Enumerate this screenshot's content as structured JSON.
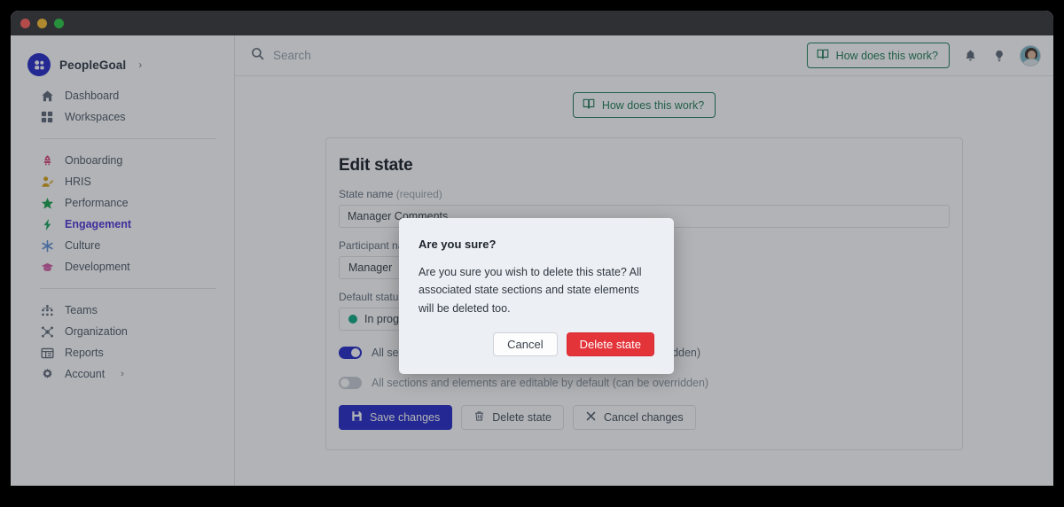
{
  "window": {
    "traffic_lights": [
      "close",
      "minimize",
      "maximize"
    ]
  },
  "sidebar": {
    "brand": {
      "name": "PeopleGoal",
      "caret": "›",
      "logo_icon": "peoplegoal-logo-icon"
    },
    "groups": [
      {
        "items": [
          {
            "label": "Dashboard",
            "icon": "home-icon",
            "color": "#5c6674",
            "active": false
          },
          {
            "label": "Workspaces",
            "icon": "grid-icon",
            "color": "#5c6674",
            "active": false
          }
        ]
      },
      {
        "items": [
          {
            "label": "Onboarding",
            "icon": "rocket-icon",
            "color": "#d93d7a",
            "active": false
          },
          {
            "label": "HRIS",
            "icon": "user-edit-icon",
            "color": "#d8a212",
            "active": false
          },
          {
            "label": "Performance",
            "icon": "star-icon",
            "color": "#17a24a",
            "active": false
          },
          {
            "label": "Engagement",
            "icon": "lightning-icon",
            "color": "#18a558",
            "active": true
          },
          {
            "label": "Culture",
            "icon": "asterisk-icon",
            "color": "#5b8ed6",
            "active": false
          },
          {
            "label": "Development",
            "icon": "graduation-cap-icon",
            "color": "#d559a5",
            "active": false
          }
        ]
      },
      {
        "items": [
          {
            "label": "Teams",
            "icon": "teams-icon",
            "color": "#5c6674",
            "active": false
          },
          {
            "label": "Organization",
            "icon": "organization-icon",
            "color": "#5c6674",
            "active": false
          },
          {
            "label": "Reports",
            "icon": "reports-icon",
            "color": "#5c6674",
            "active": false
          },
          {
            "label": "Account",
            "icon": "gear-icon",
            "color": "#5c6674",
            "active": false,
            "caret": "›"
          }
        ]
      }
    ]
  },
  "topbar": {
    "search": {
      "placeholder": "Search",
      "value": "",
      "icon": "search-icon"
    },
    "help_button": {
      "label": "How does this work?",
      "icon": "book-icon",
      "color": "#1f7a52"
    },
    "notifications_icon": "bell-icon",
    "ideas_icon": "lightbulb-icon",
    "avatar": "user-avatar"
  },
  "content": {
    "help_button": {
      "label": "How does this work?",
      "icon": "book-icon",
      "color": "#1f7a52"
    },
    "card": {
      "title": "Edit state",
      "state_name": {
        "label": "State name",
        "required_hint": "(required)",
        "value": "Manager Comments",
        "placeholder": "State name"
      },
      "participant": {
        "label": "Participant name",
        "value": "Manager"
      },
      "default_status": {
        "label": "Default status",
        "value": "In progress",
        "dot_color": "#0aa97f"
      },
      "toggles": [
        {
          "label": "All sections and elements are visible by default (can be overridden)",
          "on": true
        },
        {
          "label": "All sections and elements are editable by default (can be overridden)",
          "on": false
        }
      ],
      "buttons": [
        {
          "label": "Save changes",
          "icon": "save-icon",
          "style": "primary"
        },
        {
          "label": "Delete state",
          "icon": "trash-icon",
          "style": "plain"
        },
        {
          "label": "Cancel changes",
          "icon": "close-icon",
          "style": "plain"
        }
      ]
    }
  },
  "modal": {
    "title": "Are you sure?",
    "body": "Are you sure you wish to delete this state? All associated state sections and state elements will be deleted too.",
    "cancel_label": "Cancel",
    "confirm_label": "Delete state",
    "confirm_color": "#e3343a"
  }
}
